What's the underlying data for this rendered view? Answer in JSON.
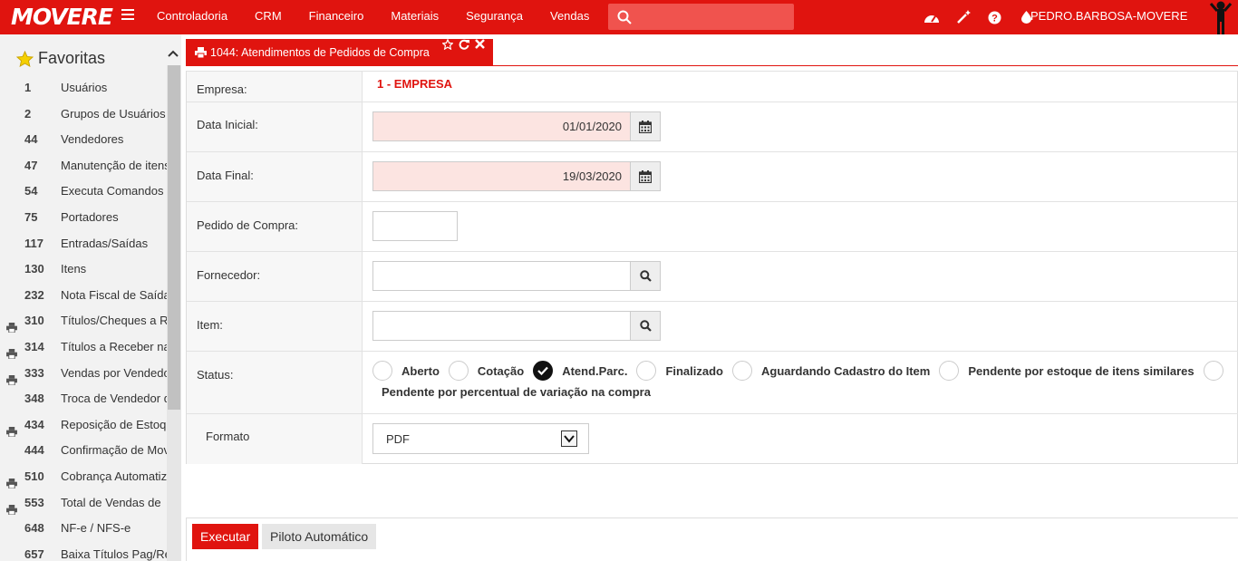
{
  "brand": {
    "logo_text": "MOVERE",
    "accent": "#e0140f"
  },
  "nav": {
    "menu": [
      "Controladoria",
      "CRM",
      "Financeiro",
      "Materiais",
      "Segurança",
      "Vendas"
    ],
    "search_placeholder": "",
    "icons": [
      "dashboard-icon",
      "magic-wand-icon",
      "help-icon",
      "drop-icon"
    ],
    "username": "PEDRO.BARBOSA-MOVERE"
  },
  "sidebar": {
    "title": "Favoritas",
    "items": [
      {
        "num": "1",
        "label": "Usuários",
        "printer": false
      },
      {
        "num": "2",
        "label": "Grupos de Usuários",
        "printer": false
      },
      {
        "num": "44",
        "label": "Vendedores",
        "printer": false
      },
      {
        "num": "47",
        "label": "Manutenção de itens",
        "printer": false
      },
      {
        "num": "54",
        "label": "Executa Comandos",
        "printer": false
      },
      {
        "num": "75",
        "label": "Portadores",
        "printer": false
      },
      {
        "num": "117",
        "label": "Entradas/Saídas",
        "printer": false
      },
      {
        "num": "130",
        "label": "Itens",
        "printer": false
      },
      {
        "num": "232",
        "label": "Nota Fiscal de Saída",
        "printer": false
      },
      {
        "num": "310",
        "label": "Títulos/Cheques a R",
        "printer": true
      },
      {
        "num": "314",
        "label": "Títulos a Receber na",
        "printer": true
      },
      {
        "num": "333",
        "label": "Vendas por Vendedo",
        "printer": true
      },
      {
        "num": "348",
        "label": "Troca de Vendedor d",
        "printer": false
      },
      {
        "num": "434",
        "label": "Reposição de Estoqu",
        "printer": true
      },
      {
        "num": "444",
        "label": "Confirmação de Mov",
        "printer": false
      },
      {
        "num": "510",
        "label": "Cobrança Automatiz",
        "printer": true
      },
      {
        "num": "553",
        "label": "Total de Vendas de",
        "printer": true
      },
      {
        "num": "648",
        "label": "NF-e / NFS-e",
        "printer": false
      },
      {
        "num": "657",
        "label": "Baixa Títulos Pag/Re",
        "printer": false
      }
    ]
  },
  "tab": {
    "title": "1044: Atendimentos de Pedidos de Compra"
  },
  "form": {
    "empresa": {
      "label": "Empresa:",
      "value": "1 - EMPRESA"
    },
    "data_inicial": {
      "label": "Data Inicial:",
      "value": "01/01/2020"
    },
    "data_final": {
      "label": "Data Final:",
      "value": "19/03/2020"
    },
    "pedido": {
      "label": "Pedido de Compra:",
      "value": ""
    },
    "fornecedor": {
      "label": "Fornecedor:",
      "value": ""
    },
    "item": {
      "label": "Item:",
      "value": ""
    },
    "status": {
      "label": "Status:",
      "options": [
        {
          "label": "Aberto",
          "checked": false
        },
        {
          "label": "Cotação",
          "checked": false
        },
        {
          "label": "Atend.Parc.",
          "checked": true
        },
        {
          "label": "Finalizado",
          "checked": false
        },
        {
          "label": "Aguardando Cadastro do Item",
          "checked": false
        },
        {
          "label": "Pendente por estoque de itens similares",
          "checked": false
        },
        {
          "label": "Pendente por percentual de variação na compra",
          "checked": false
        }
      ]
    },
    "formato": {
      "label": "Formato",
      "value": "PDF"
    }
  },
  "footer": {
    "execute_label": "Executar",
    "auto_label": "Piloto Automático"
  }
}
